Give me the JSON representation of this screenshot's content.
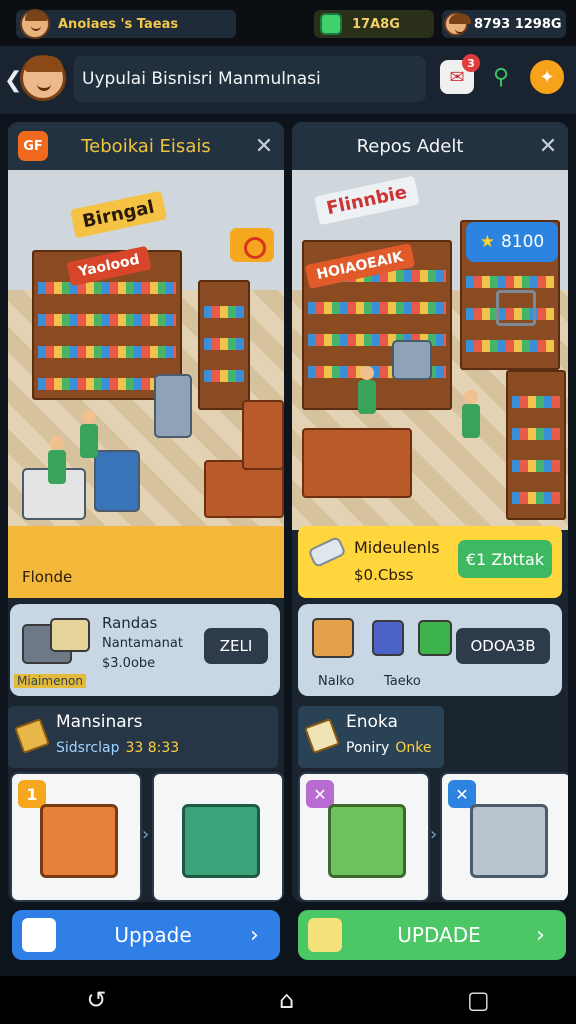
{
  "status_bar": {
    "player_label": "Anoiaes 's Taeas",
    "gem_value": "17A8G",
    "coin_value": "8793 1298G"
  },
  "header": {
    "back_icon": "chevron-left-icon",
    "title": "Uypulai Bisnisri Manmulnasi",
    "notification_count": "3"
  },
  "left_panel": {
    "title": "Teboikai Eisais",
    "badge_text": "GF",
    "scene_sign": "Birngal",
    "scene_sign2": "Yaolood",
    "strip_label": "Flonde",
    "card": {
      "name": "Randas",
      "sub": "Nantamanat",
      "price": "$3.0obe",
      "tag": "Miaimenon",
      "action": "ZELI"
    },
    "section": {
      "title": "Mansinars",
      "sub": "Sidsrclap",
      "sub_value": "33 8:33"
    },
    "tile_badge": "1"
  },
  "right_panel": {
    "title": "Repos Adelt",
    "scene_sign": "Flinnbie",
    "scene_sign2": "HOIAOEAIK",
    "price_chip": "8100",
    "strip": {
      "title": "Mideulenls",
      "sub": "$0.Cbss",
      "action": "€1 Zbttak"
    },
    "card": {
      "item1": "Nalko",
      "item2": "Taeko",
      "action": "ODOA3B"
    },
    "section": {
      "title": "Enoka",
      "sub": "Poniry",
      "sub_value": "Onke"
    },
    "tile_badge": "✕"
  },
  "buttons": {
    "left": "Uppade",
    "right": "UPDADE"
  },
  "colors": {
    "accent_orange": "#f5a81d",
    "accent_blue": "#2f7fe6",
    "accent_green": "#4cc766",
    "panel_bg": "#1b2530"
  }
}
